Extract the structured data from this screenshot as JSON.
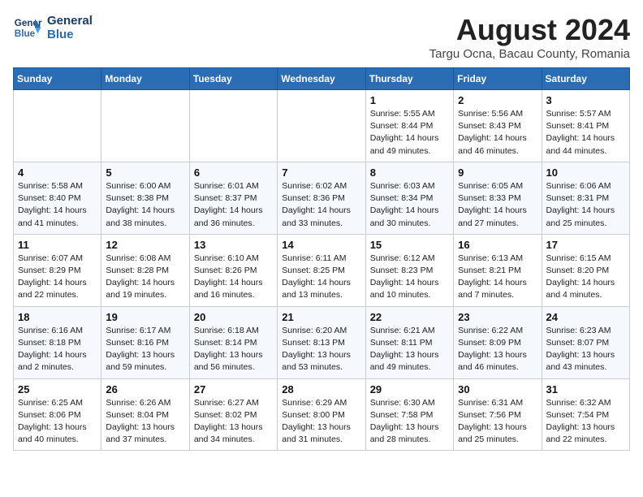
{
  "header": {
    "logo_line1": "General",
    "logo_line2": "Blue",
    "month_year": "August 2024",
    "location": "Targu Ocna, Bacau County, Romania"
  },
  "weekdays": [
    "Sunday",
    "Monday",
    "Tuesday",
    "Wednesday",
    "Thursday",
    "Friday",
    "Saturday"
  ],
  "weeks": [
    [
      {
        "day": "",
        "info": ""
      },
      {
        "day": "",
        "info": ""
      },
      {
        "day": "",
        "info": ""
      },
      {
        "day": "",
        "info": ""
      },
      {
        "day": "1",
        "info": "Sunrise: 5:55 AM\nSunset: 8:44 PM\nDaylight: 14 hours\nand 49 minutes."
      },
      {
        "day": "2",
        "info": "Sunrise: 5:56 AM\nSunset: 8:43 PM\nDaylight: 14 hours\nand 46 minutes."
      },
      {
        "day": "3",
        "info": "Sunrise: 5:57 AM\nSunset: 8:41 PM\nDaylight: 14 hours\nand 44 minutes."
      }
    ],
    [
      {
        "day": "4",
        "info": "Sunrise: 5:58 AM\nSunset: 8:40 PM\nDaylight: 14 hours\nand 41 minutes."
      },
      {
        "day": "5",
        "info": "Sunrise: 6:00 AM\nSunset: 8:38 PM\nDaylight: 14 hours\nand 38 minutes."
      },
      {
        "day": "6",
        "info": "Sunrise: 6:01 AM\nSunset: 8:37 PM\nDaylight: 14 hours\nand 36 minutes."
      },
      {
        "day": "7",
        "info": "Sunrise: 6:02 AM\nSunset: 8:36 PM\nDaylight: 14 hours\nand 33 minutes."
      },
      {
        "day": "8",
        "info": "Sunrise: 6:03 AM\nSunset: 8:34 PM\nDaylight: 14 hours\nand 30 minutes."
      },
      {
        "day": "9",
        "info": "Sunrise: 6:05 AM\nSunset: 8:33 PM\nDaylight: 14 hours\nand 27 minutes."
      },
      {
        "day": "10",
        "info": "Sunrise: 6:06 AM\nSunset: 8:31 PM\nDaylight: 14 hours\nand 25 minutes."
      }
    ],
    [
      {
        "day": "11",
        "info": "Sunrise: 6:07 AM\nSunset: 8:29 PM\nDaylight: 14 hours\nand 22 minutes."
      },
      {
        "day": "12",
        "info": "Sunrise: 6:08 AM\nSunset: 8:28 PM\nDaylight: 14 hours\nand 19 minutes."
      },
      {
        "day": "13",
        "info": "Sunrise: 6:10 AM\nSunset: 8:26 PM\nDaylight: 14 hours\nand 16 minutes."
      },
      {
        "day": "14",
        "info": "Sunrise: 6:11 AM\nSunset: 8:25 PM\nDaylight: 14 hours\nand 13 minutes."
      },
      {
        "day": "15",
        "info": "Sunrise: 6:12 AM\nSunset: 8:23 PM\nDaylight: 14 hours\nand 10 minutes."
      },
      {
        "day": "16",
        "info": "Sunrise: 6:13 AM\nSunset: 8:21 PM\nDaylight: 14 hours\nand 7 minutes."
      },
      {
        "day": "17",
        "info": "Sunrise: 6:15 AM\nSunset: 8:20 PM\nDaylight: 14 hours\nand 4 minutes."
      }
    ],
    [
      {
        "day": "18",
        "info": "Sunrise: 6:16 AM\nSunset: 8:18 PM\nDaylight: 14 hours\nand 2 minutes."
      },
      {
        "day": "19",
        "info": "Sunrise: 6:17 AM\nSunset: 8:16 PM\nDaylight: 13 hours\nand 59 minutes."
      },
      {
        "day": "20",
        "info": "Sunrise: 6:18 AM\nSunset: 8:14 PM\nDaylight: 13 hours\nand 56 minutes."
      },
      {
        "day": "21",
        "info": "Sunrise: 6:20 AM\nSunset: 8:13 PM\nDaylight: 13 hours\nand 53 minutes."
      },
      {
        "day": "22",
        "info": "Sunrise: 6:21 AM\nSunset: 8:11 PM\nDaylight: 13 hours\nand 49 minutes."
      },
      {
        "day": "23",
        "info": "Sunrise: 6:22 AM\nSunset: 8:09 PM\nDaylight: 13 hours\nand 46 minutes."
      },
      {
        "day": "24",
        "info": "Sunrise: 6:23 AM\nSunset: 8:07 PM\nDaylight: 13 hours\nand 43 minutes."
      }
    ],
    [
      {
        "day": "25",
        "info": "Sunrise: 6:25 AM\nSunset: 8:06 PM\nDaylight: 13 hours\nand 40 minutes."
      },
      {
        "day": "26",
        "info": "Sunrise: 6:26 AM\nSunset: 8:04 PM\nDaylight: 13 hours\nand 37 minutes."
      },
      {
        "day": "27",
        "info": "Sunrise: 6:27 AM\nSunset: 8:02 PM\nDaylight: 13 hours\nand 34 minutes."
      },
      {
        "day": "28",
        "info": "Sunrise: 6:29 AM\nSunset: 8:00 PM\nDaylight: 13 hours\nand 31 minutes."
      },
      {
        "day": "29",
        "info": "Sunrise: 6:30 AM\nSunset: 7:58 PM\nDaylight: 13 hours\nand 28 minutes."
      },
      {
        "day": "30",
        "info": "Sunrise: 6:31 AM\nSunset: 7:56 PM\nDaylight: 13 hours\nand 25 minutes."
      },
      {
        "day": "31",
        "info": "Sunrise: 6:32 AM\nSunset: 7:54 PM\nDaylight: 13 hours\nand 22 minutes."
      }
    ]
  ]
}
